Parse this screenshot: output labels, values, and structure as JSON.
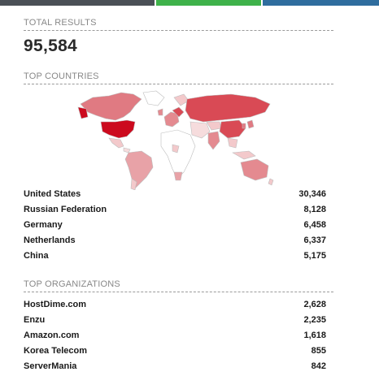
{
  "topbar": {
    "colors": [
      "#4a5056",
      "#5a5f64",
      "#3fb24a",
      "#2f6d9e"
    ]
  },
  "total": {
    "title": "TOTAL RESULTS",
    "value": "95,584"
  },
  "countries": {
    "title": "TOP COUNTRIES",
    "items": [
      {
        "name": "United States",
        "count": "30,346"
      },
      {
        "name": "Russian Federation",
        "count": "8,128"
      },
      {
        "name": "Germany",
        "count": "6,458"
      },
      {
        "name": "Netherlands",
        "count": "6,337"
      },
      {
        "name": "China",
        "count": "5,175"
      }
    ]
  },
  "organizations": {
    "title": "TOP ORGANIZATIONS",
    "items": [
      {
        "name": "HostDime.com",
        "count": "2,628"
      },
      {
        "name": "Enzu",
        "count": "2,235"
      },
      {
        "name": "Amazon.com",
        "count": "1,618"
      },
      {
        "name": "Korea Telecom",
        "count": "855"
      },
      {
        "name": "ServerMania",
        "count": "842"
      }
    ]
  },
  "map_colors": {
    "max": "#cc0a1e",
    "high": "#d94a55",
    "mid": "#e48a90",
    "low": "#f3c9cb",
    "none": "#ffffff",
    "border": "#c8c8c8"
  }
}
